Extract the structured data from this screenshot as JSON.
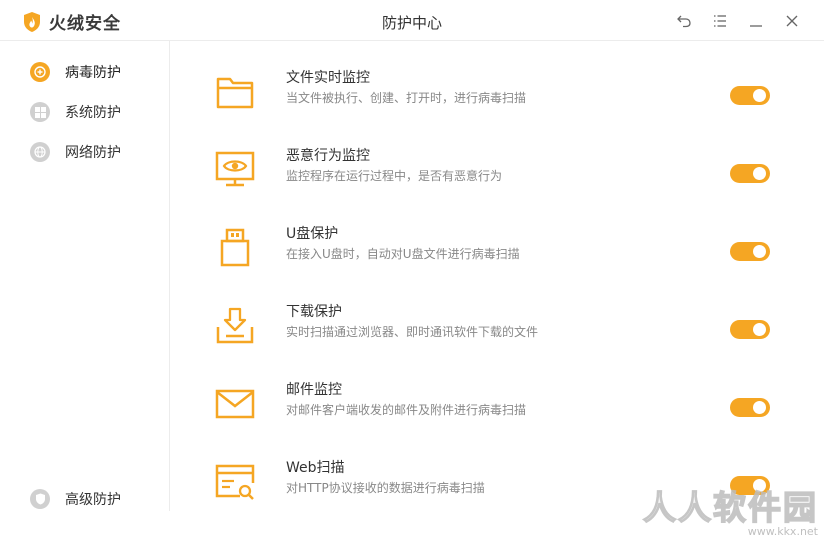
{
  "app": {
    "name": "火绒安全",
    "window_title": "防护中心",
    "accent_color": "#f5a623"
  },
  "window_controls": [
    {
      "name": "back-icon"
    },
    {
      "name": "menu-icon"
    },
    {
      "name": "minimize-icon"
    },
    {
      "name": "close-icon"
    }
  ],
  "sidebar": {
    "items": [
      {
        "label": "病毒防护",
        "icon": "plus-circle-icon",
        "active": true
      },
      {
        "label": "系统防护",
        "icon": "windows-icon",
        "active": false
      },
      {
        "label": "网络防护",
        "icon": "network-icon",
        "active": false
      }
    ],
    "bottom_item": {
      "label": "高级防护",
      "icon": "shield-icon"
    }
  },
  "protections": [
    {
      "title": "文件实时监控",
      "description": "当文件被执行、创建、打开时，进行病毒扫描",
      "icon": "folder-icon",
      "enabled": true
    },
    {
      "title": "恶意行为监控",
      "description": "监控程序在运行过程中，是否有恶意行为",
      "icon": "monitor-eye-icon",
      "enabled": true
    },
    {
      "title": "U盘保护",
      "description": "在接入U盘时，自动对U盘文件进行病毒扫描",
      "icon": "usb-icon",
      "enabled": true
    },
    {
      "title": "下载保护",
      "description": "实时扫描通过浏览器、即时通讯软件下载的文件",
      "icon": "download-icon",
      "enabled": true
    },
    {
      "title": "邮件监控",
      "description": "对邮件客户端收发的邮件及附件进行病毒扫描",
      "icon": "mail-icon",
      "enabled": true
    },
    {
      "title": "Web扫描",
      "description": "对HTTP协议接收的数据进行病毒扫描",
      "icon": "web-scan-icon",
      "enabled": true
    }
  ],
  "watermark": {
    "title": "人人软件园",
    "url": "www.kkx.net"
  }
}
